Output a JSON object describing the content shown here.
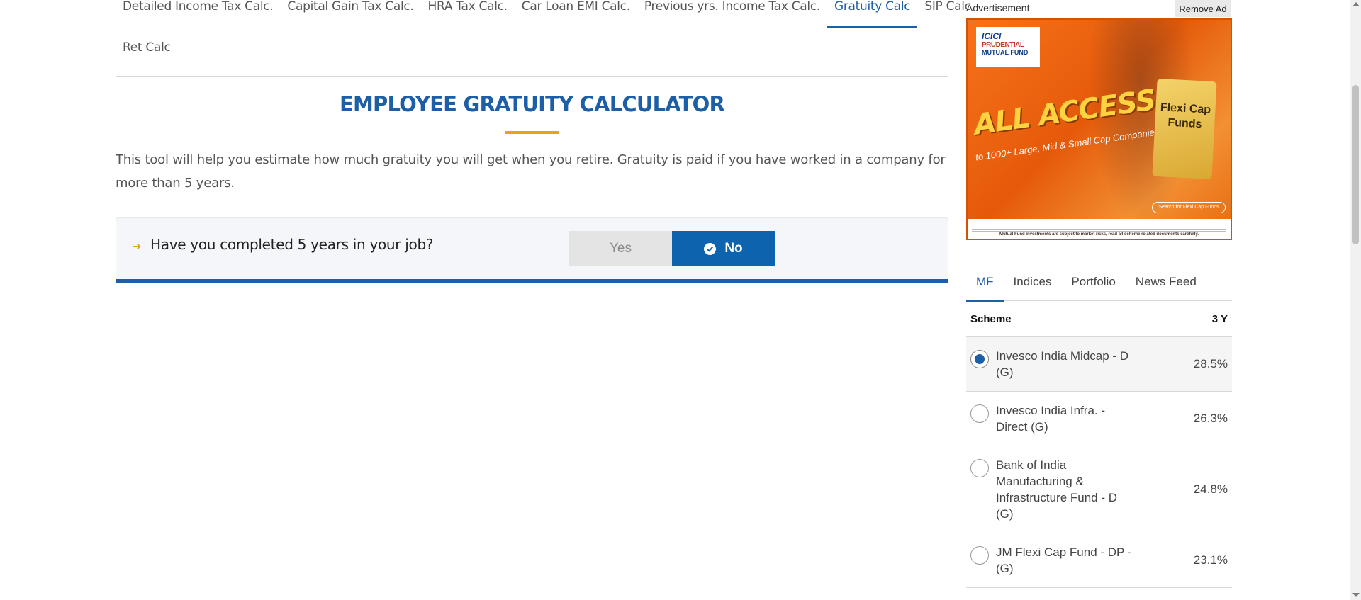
{
  "nav": {
    "row1": [
      {
        "label": "Detailed Income Tax Calc.",
        "active": false
      },
      {
        "label": "Capital Gain Tax Calc.",
        "active": false
      },
      {
        "label": "HRA Tax Calc.",
        "active": false
      },
      {
        "label": "Car Loan EMI Calc.",
        "active": false
      },
      {
        "label": "Previous yrs. Income Tax Calc.",
        "active": false
      },
      {
        "label": "Gratuity Calc",
        "active": true
      },
      {
        "label": "SIP Calc",
        "active": false
      }
    ],
    "row2": [
      {
        "label": "Ret Calc",
        "active": false
      }
    ]
  },
  "main": {
    "title": "EMPLOYEE GRATUITY CALCULATOR",
    "intro": "This tool will help you estimate how much gratuity you will get when you retire. Gratuity is paid if you have worked in a company for more than 5 years.",
    "question": {
      "text": "Have you completed 5 years in your job?",
      "yes_label": "Yes",
      "no_label": "No",
      "selected": "No"
    }
  },
  "sidebar": {
    "ad_label": "Advertisement",
    "remove_ad_label": "Remove Ad",
    "ad": {
      "logo_line1": "ICICI",
      "logo_line2": "PRUDENTIAL",
      "logo_line3": "MUTUAL FUND",
      "headline": "ALL ACCESS",
      "subline": "to 1000+ Large, Mid & Small Cap Companies*",
      "card_text": "Flexi Cap Funds",
      "search_text": "Search for Flexi Cap Funds",
      "disclaimer": "Mutual Fund investments are subject to market risks, read all scheme related documents carefully."
    },
    "tabs": [
      {
        "label": "MF",
        "active": true
      },
      {
        "label": "Indices",
        "active": false
      },
      {
        "label": "Portfolio",
        "active": false
      },
      {
        "label": "News Feed",
        "active": false
      }
    ],
    "table": {
      "col_scheme": "Scheme",
      "col_period": "3 Y",
      "rows": [
        {
          "name": "Invesco India Midcap - D (G)",
          "return": "28.5%",
          "selected": true
        },
        {
          "name": "Invesco India Infra. - Direct (G)",
          "return": "26.3%",
          "selected": false
        },
        {
          "name": "Bank of India Manufacturing & Infrastructure Fund - D (G)",
          "return": "24.8%",
          "selected": false
        },
        {
          "name": "JM Flexi Cap Fund - DP - (G)",
          "return": "23.1%",
          "selected": false
        }
      ]
    }
  },
  "colors": {
    "accent_blue": "#1d5fa7",
    "button_blue": "#0d63ad",
    "underline_orange": "#e8a317",
    "ad_orange": "#f7721a"
  }
}
